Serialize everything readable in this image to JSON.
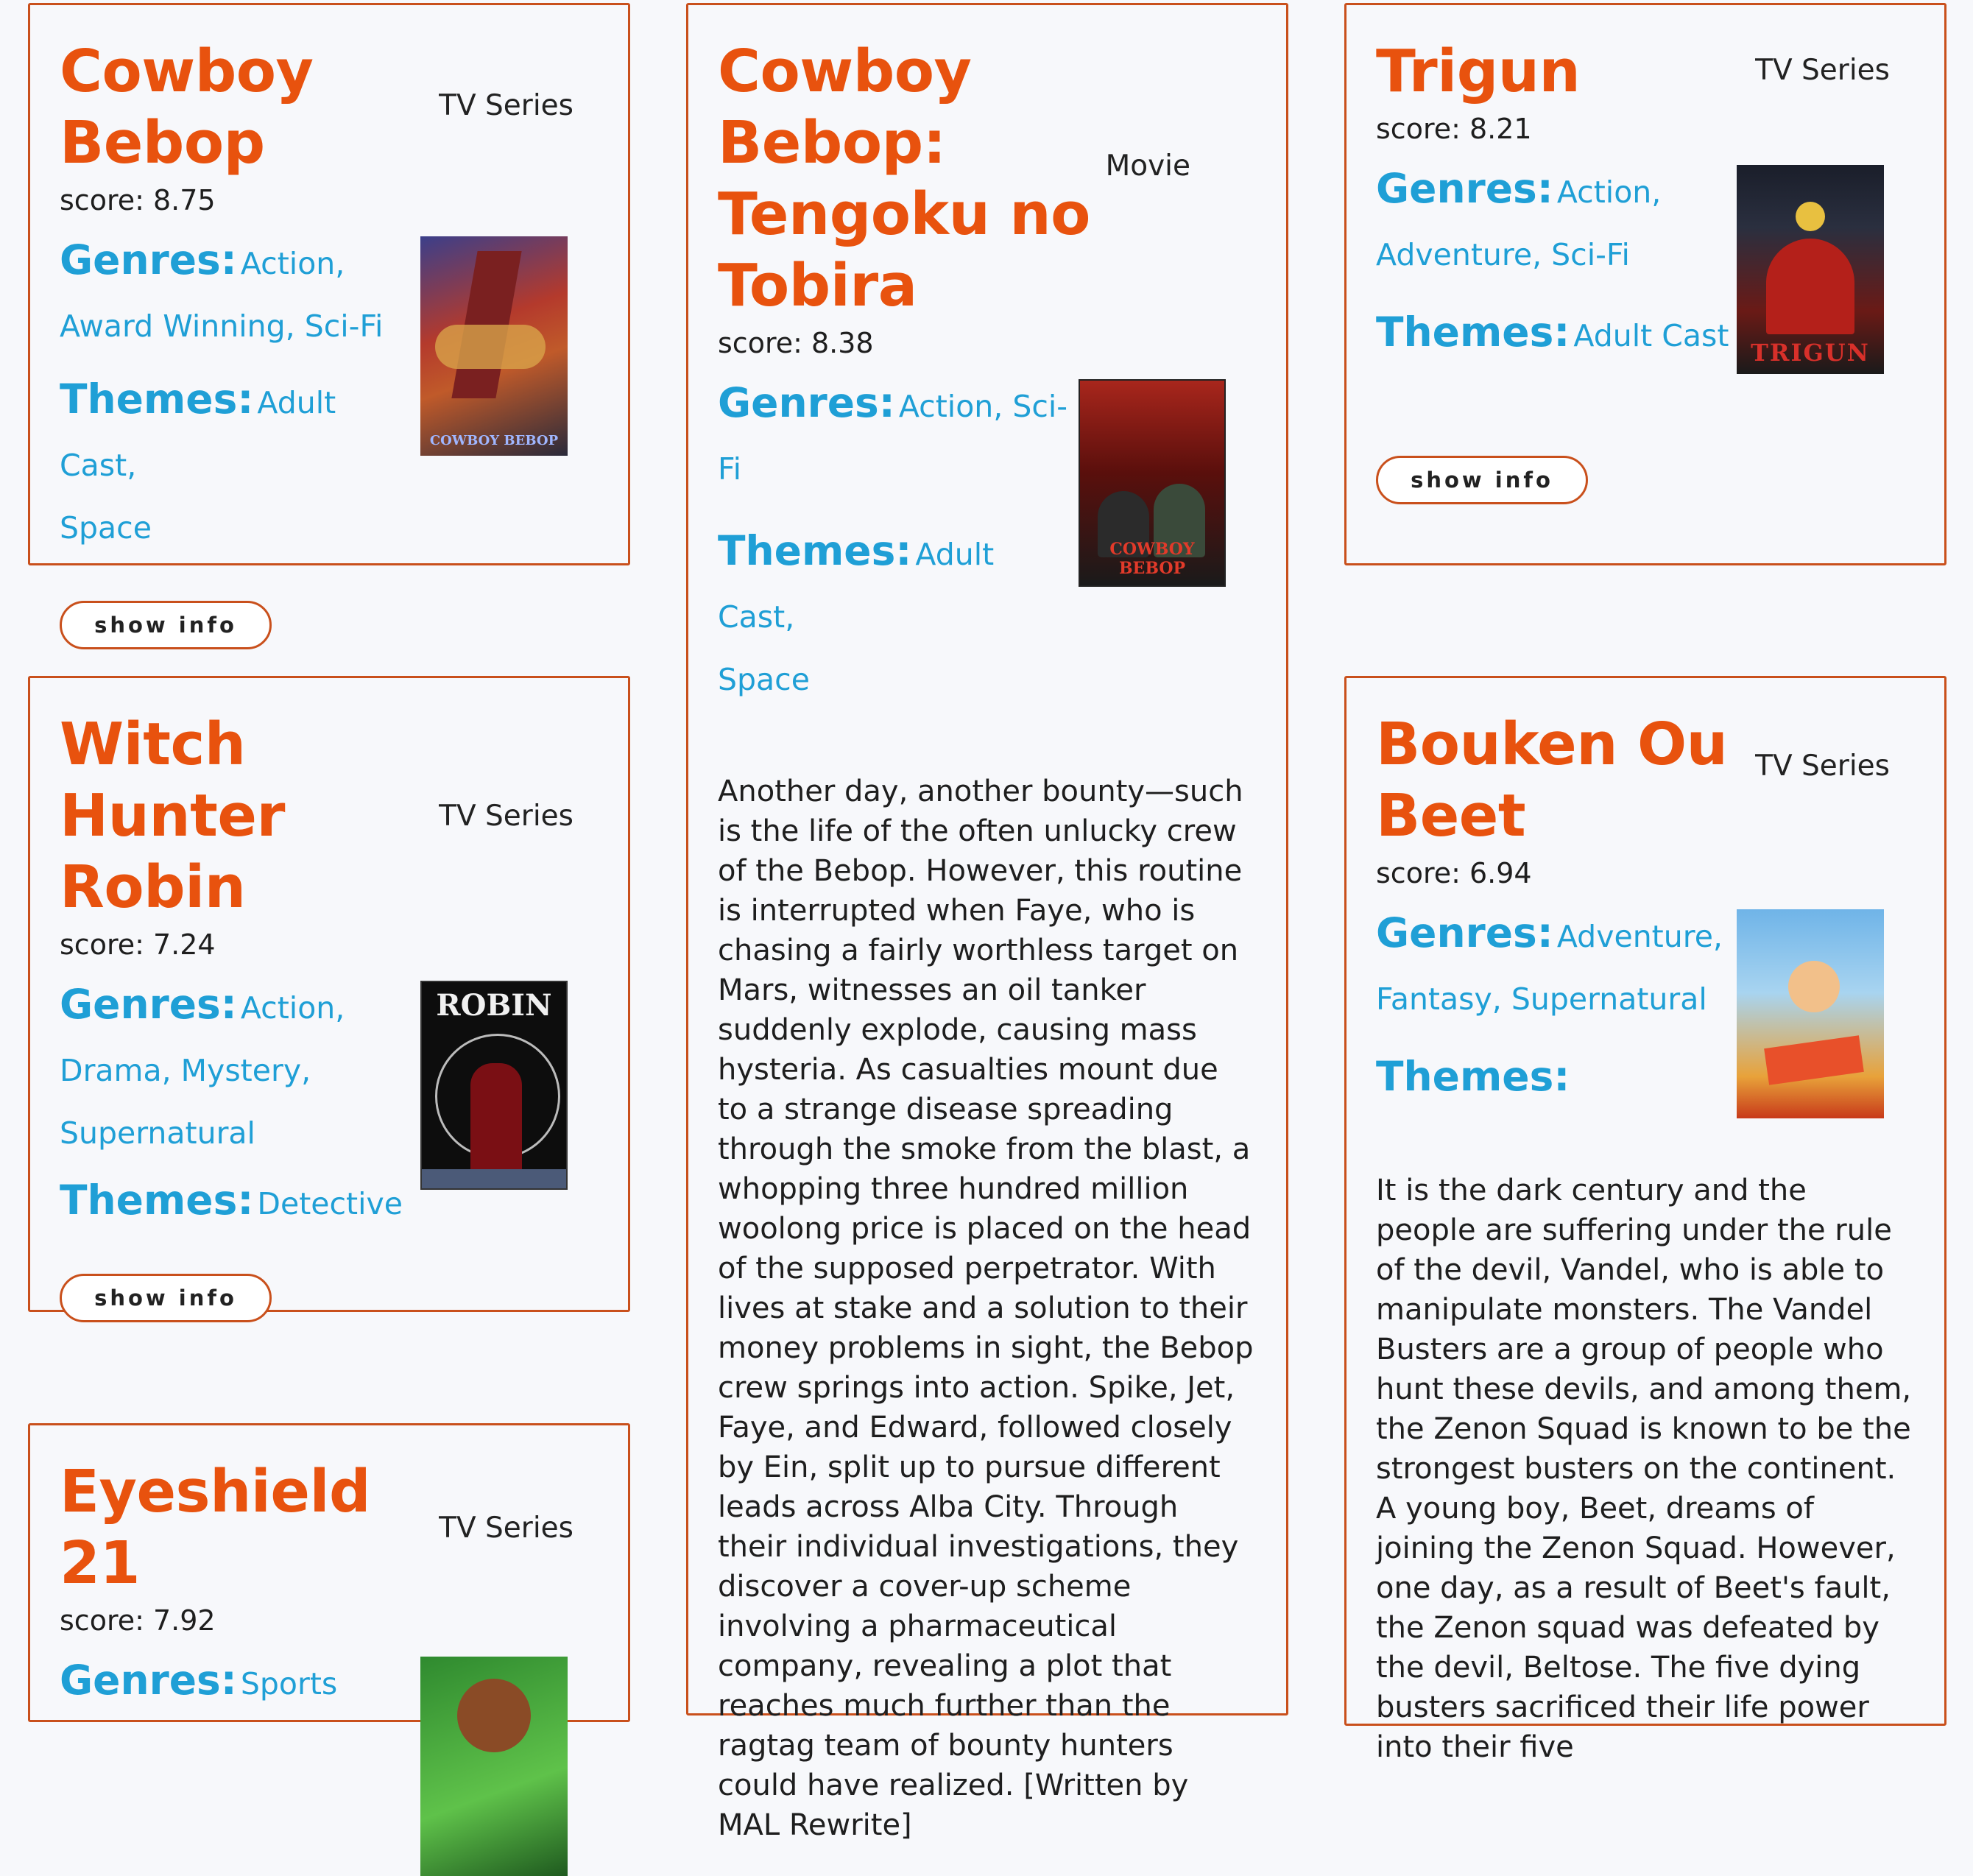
{
  "cards": {
    "bebop": {
      "title_lines": [
        "Cowboy",
        "Bebop"
      ],
      "type": "TV Series",
      "score": "score: 8.75",
      "genres_key": "Genres:",
      "genres_lines": [
        "Action,",
        "Award Winning, Sci-Fi"
      ],
      "themes_key": "Themes:",
      "themes_lines": [
        "Adult Cast,",
        "Space"
      ],
      "poster_caption": "COWBOY BEBOP",
      "button": "show info"
    },
    "bebop_movie": {
      "title_lines": [
        "Cowboy",
        "Bebop:",
        "Tengoku no",
        "Tobira"
      ],
      "type": "Movie",
      "score": "score: 8.38",
      "genres_key": "Genres:",
      "genres_lines": [
        "Action, Sci-Fi"
      ],
      "themes_key": "Themes:",
      "themes_lines": [
        "Adult Cast,",
        "Space"
      ],
      "poster_caption": "COWBOY BEBOP",
      "synopsis": "Another day, another bounty—such is the life of the often unlucky crew of the Bebop. However, this routine is interrupted when Faye, who is chasing a fairly worthless target on Mars, witnesses an oil tanker suddenly explode, causing mass hysteria. As casualties mount due to a strange disease spreading through the smoke from the blast, a whopping three hundred million woolong price is placed on the head of the supposed perpetrator. With lives at stake and a solution to their money problems in sight, the Bebop crew springs into action. Spike, Jet, Faye, and Edward, followed closely by Ein, split up to pursue different leads across Alba City. Through their individual investigations, they discover a cover-up scheme involving a pharmaceutical company, revealing a plot that reaches much further than the ragtag team of bounty hunters could have realized. [Written by MAL Rewrite]"
    },
    "trigun": {
      "title_lines": [
        "Trigun"
      ],
      "type": "TV Series",
      "score": "score: 8.21",
      "genres_key": "Genres:",
      "genres_lines": [
        "Action,",
        "Adventure, Sci-Fi"
      ],
      "themes_key": "Themes:",
      "themes_lines": [
        "Adult Cast"
      ],
      "poster_caption": "TRIGUN",
      "button": "show info"
    },
    "robin": {
      "title_lines": [
        "Witch",
        "Hunter",
        "Robin"
      ],
      "type": "TV Series",
      "score": "score: 7.24",
      "genres_key": "Genres:",
      "genres_lines": [
        "Action,",
        "Drama, Mystery,",
        "Supernatural"
      ],
      "themes_key": "Themes:",
      "themes_lines": [
        "Detective"
      ],
      "poster_caption": "ROBIN",
      "button": "show info"
    },
    "beet": {
      "title_lines": [
        "Bouken Ou",
        "Beet"
      ],
      "type": "TV Series",
      "score": "score: 6.94",
      "genres_key": "Genres:",
      "genres_lines": [
        "Adventure,",
        "Fantasy, Supernatural"
      ],
      "themes_key": "Themes:",
      "themes_lines": [
        ""
      ],
      "synopsis": "It is the dark century and the people are suffering under the rule of the devil, Vandel, who is able to manipulate monsters. The Vandel Busters are a group of people who hunt these devils, and among them, the Zenon Squad is known to be the strongest busters on the continent. A young boy, Beet, dreams of joining the Zenon Squad. However, one day, as a result of Beet's fault, the Zenon squad was defeated by the devil, Beltose. The five dying busters sacrificed their life power into their five"
    },
    "eyeshield": {
      "title_lines": [
        "Eyeshield 21"
      ],
      "type": "TV Series",
      "score": "score: 7.92",
      "genres_key": "Genres:",
      "genres_lines": [
        "Sports"
      ]
    }
  },
  "colors": {
    "title": "#e8520e",
    "tag": "#1f9fd6",
    "border": "#c9501c"
  }
}
